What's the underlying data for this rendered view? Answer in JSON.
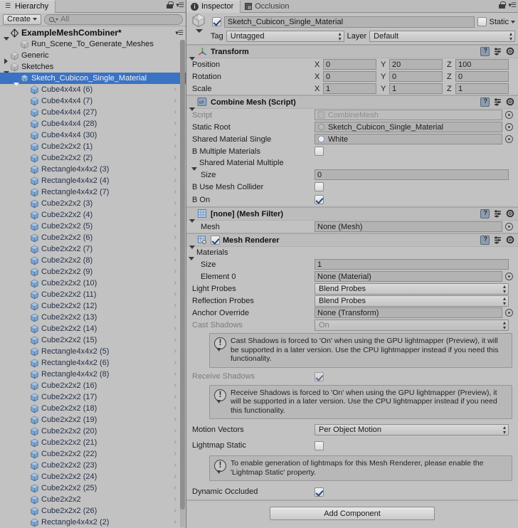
{
  "hierarchy": {
    "tab_label": "Hierarchy",
    "tab_icon": "hierarchy-icon",
    "create_label": "Create",
    "search_placeholder": "All",
    "search_value": "All",
    "scene_name": "ExampleMeshCombiner*",
    "selected_color": "#3a72c4",
    "items": [
      {
        "label": "Run_Scene_To_Generate_Meshes",
        "indent": 2,
        "arrow": "none",
        "icon": "gameobject-icon",
        "selected": false,
        "chevron": false
      },
      {
        "label": "Generic",
        "indent": 1,
        "arrow": "closed",
        "icon": "gameobject-icon",
        "selected": false,
        "chevron": false
      },
      {
        "label": "Sketches",
        "indent": 1,
        "arrow": "open",
        "icon": "gameobject-icon",
        "selected": false,
        "chevron": false
      },
      {
        "label": "Sketch_Cubicon_Single_Material",
        "indent": 2,
        "arrow": "open",
        "icon": "prefab-icon",
        "selected": true,
        "chevron": false
      },
      {
        "label": "Cube4x4x4 (6)",
        "indent": 3,
        "arrow": "none",
        "icon": "prefab-icon",
        "selected": false,
        "chevron": true
      },
      {
        "label": "Cube4x4x4 (7)",
        "indent": 3,
        "arrow": "none",
        "icon": "prefab-icon",
        "selected": false,
        "chevron": true
      },
      {
        "label": "Cube4x4x4 (27)",
        "indent": 3,
        "arrow": "none",
        "icon": "prefab-icon",
        "selected": false,
        "chevron": true
      },
      {
        "label": "Cube4x4x4 (28)",
        "indent": 3,
        "arrow": "none",
        "icon": "prefab-icon",
        "selected": false,
        "chevron": true
      },
      {
        "label": "Cube4x4x4 (30)",
        "indent": 3,
        "arrow": "none",
        "icon": "prefab-icon",
        "selected": false,
        "chevron": true
      },
      {
        "label": "Cube2x2x2 (1)",
        "indent": 3,
        "arrow": "none",
        "icon": "prefab-icon",
        "selected": false,
        "chevron": true
      },
      {
        "label": "Cube2x2x2 (2)",
        "indent": 3,
        "arrow": "none",
        "icon": "prefab-icon",
        "selected": false,
        "chevron": true
      },
      {
        "label": "Rectangle4x4x2 (3)",
        "indent": 3,
        "arrow": "none",
        "icon": "prefab-icon",
        "selected": false,
        "chevron": true
      },
      {
        "label": "Rectangle4x4x2 (4)",
        "indent": 3,
        "arrow": "none",
        "icon": "prefab-icon",
        "selected": false,
        "chevron": true
      },
      {
        "label": "Rectangle4x4x2 (7)",
        "indent": 3,
        "arrow": "none",
        "icon": "prefab-icon",
        "selected": false,
        "chevron": true
      },
      {
        "label": "Cube2x2x2 (3)",
        "indent": 3,
        "arrow": "none",
        "icon": "prefab-icon",
        "selected": false,
        "chevron": true
      },
      {
        "label": "Cube2x2x2 (4)",
        "indent": 3,
        "arrow": "none",
        "icon": "prefab-icon",
        "selected": false,
        "chevron": true
      },
      {
        "label": "Cube2x2x2 (5)",
        "indent": 3,
        "arrow": "none",
        "icon": "prefab-icon",
        "selected": false,
        "chevron": true
      },
      {
        "label": "Cube2x2x2 (6)",
        "indent": 3,
        "arrow": "none",
        "icon": "prefab-icon",
        "selected": false,
        "chevron": true
      },
      {
        "label": "Cube2x2x2 (7)",
        "indent": 3,
        "arrow": "none",
        "icon": "prefab-icon",
        "selected": false,
        "chevron": true
      },
      {
        "label": "Cube2x2x2 (8)",
        "indent": 3,
        "arrow": "none",
        "icon": "prefab-icon",
        "selected": false,
        "chevron": true
      },
      {
        "label": "Cube2x2x2 (9)",
        "indent": 3,
        "arrow": "none",
        "icon": "prefab-icon",
        "selected": false,
        "chevron": true
      },
      {
        "label": "Cube2x2x2 (10)",
        "indent": 3,
        "arrow": "none",
        "icon": "prefab-icon",
        "selected": false,
        "chevron": true
      },
      {
        "label": "Cube2x2x2 (11)",
        "indent": 3,
        "arrow": "none",
        "icon": "prefab-icon",
        "selected": false,
        "chevron": true
      },
      {
        "label": "Cube2x2x2 (12)",
        "indent": 3,
        "arrow": "none",
        "icon": "prefab-icon",
        "selected": false,
        "chevron": true
      },
      {
        "label": "Cube2x2x2 (13)",
        "indent": 3,
        "arrow": "none",
        "icon": "prefab-icon",
        "selected": false,
        "chevron": true
      },
      {
        "label": "Cube2x2x2 (14)",
        "indent": 3,
        "arrow": "none",
        "icon": "prefab-icon",
        "selected": false,
        "chevron": true
      },
      {
        "label": "Cube2x2x2 (15)",
        "indent": 3,
        "arrow": "none",
        "icon": "prefab-icon",
        "selected": false,
        "chevron": true
      },
      {
        "label": "Rectangle4x4x2 (5)",
        "indent": 3,
        "arrow": "none",
        "icon": "prefab-icon",
        "selected": false,
        "chevron": true
      },
      {
        "label": "Rectangle4x4x2 (6)",
        "indent": 3,
        "arrow": "none",
        "icon": "prefab-icon",
        "selected": false,
        "chevron": true
      },
      {
        "label": "Rectangle4x4x2 (8)",
        "indent": 3,
        "arrow": "none",
        "icon": "prefab-icon",
        "selected": false,
        "chevron": true
      },
      {
        "label": "Cube2x2x2 (16)",
        "indent": 3,
        "arrow": "none",
        "icon": "prefab-icon",
        "selected": false,
        "chevron": true
      },
      {
        "label": "Cube2x2x2 (17)",
        "indent": 3,
        "arrow": "none",
        "icon": "prefab-icon",
        "selected": false,
        "chevron": true
      },
      {
        "label": "Cube2x2x2 (18)",
        "indent": 3,
        "arrow": "none",
        "icon": "prefab-icon",
        "selected": false,
        "chevron": true
      },
      {
        "label": "Cube2x2x2 (19)",
        "indent": 3,
        "arrow": "none",
        "icon": "prefab-icon",
        "selected": false,
        "chevron": true
      },
      {
        "label": "Cube2x2x2 (20)",
        "indent": 3,
        "arrow": "none",
        "icon": "prefab-icon",
        "selected": false,
        "chevron": true
      },
      {
        "label": "Cube2x2x2 (21)",
        "indent": 3,
        "arrow": "none",
        "icon": "prefab-icon",
        "selected": false,
        "chevron": true
      },
      {
        "label": "Cube2x2x2 (22)",
        "indent": 3,
        "arrow": "none",
        "icon": "prefab-icon",
        "selected": false,
        "chevron": true
      },
      {
        "label": "Cube2x2x2 (23)",
        "indent": 3,
        "arrow": "none",
        "icon": "prefab-icon",
        "selected": false,
        "chevron": true
      },
      {
        "label": "Cube2x2x2 (24)",
        "indent": 3,
        "arrow": "none",
        "icon": "prefab-icon",
        "selected": false,
        "chevron": true
      },
      {
        "label": "Cube2x2x2 (25)",
        "indent": 3,
        "arrow": "none",
        "icon": "prefab-icon",
        "selected": false,
        "chevron": true
      },
      {
        "label": "Cube2x2x2",
        "indent": 3,
        "arrow": "none",
        "icon": "prefab-icon",
        "selected": false,
        "chevron": true
      },
      {
        "label": "Cube2x2x2 (26)",
        "indent": 3,
        "arrow": "none",
        "icon": "prefab-icon",
        "selected": false,
        "chevron": true
      },
      {
        "label": "Rectangle4x4x2 (2)",
        "indent": 3,
        "arrow": "none",
        "icon": "prefab-icon",
        "selected": false,
        "chevron": true
      }
    ]
  },
  "inspector": {
    "tabs": [
      {
        "label": "Inspector",
        "icon": "info-icon",
        "active": true
      },
      {
        "label": "Occlusion",
        "icon": "occlusion-icon",
        "active": false
      }
    ],
    "gameobject": {
      "enabled": true,
      "name": "Sketch_Cubicon_Single_Material",
      "static_label": "Static",
      "static_checked": false,
      "tag_label": "Tag",
      "tag_value": "Untagged",
      "layer_label": "Layer",
      "layer_value": "Default"
    },
    "transform": {
      "title": "Transform",
      "icon": "transform-icon",
      "rows": [
        {
          "label": "Position",
          "x": "0",
          "y": "20",
          "z": "100"
        },
        {
          "label": "Rotation",
          "x": "0",
          "y": "0",
          "z": "0"
        },
        {
          "label": "Scale",
          "x": "1",
          "y": "1",
          "z": "1"
        }
      ],
      "axis_labels": [
        "X",
        "Y",
        "Z"
      ]
    },
    "combine_mesh": {
      "title": "Combine Mesh (Script)",
      "icon": "script-icon",
      "script_label": "Script",
      "script_value": "CombineMesh",
      "static_root_label": "Static Root",
      "static_root_value": "Sketch_Cubicon_Single_Material",
      "shared_material_single_label": "Shared Material Single",
      "shared_material_single_value": "White",
      "b_multiple_materials_label": "B Multiple Materials",
      "b_multiple_materials_checked": false,
      "shared_material_multiple_label": "Shared Material Multiple",
      "size_label": "Size",
      "size_value": "0",
      "b_use_mesh_collider_label": "B Use Mesh Collider",
      "b_use_mesh_collider_checked": false,
      "b_on_label": "B On",
      "b_on_checked": true
    },
    "mesh_filter": {
      "title": "[none] (Mesh Filter)",
      "icon": "mesh-filter-icon",
      "mesh_label": "Mesh",
      "mesh_value": "None (Mesh)"
    },
    "mesh_renderer": {
      "title": "Mesh Renderer",
      "icon": "mesh-renderer-icon",
      "enabled": true,
      "materials_label": "Materials",
      "size_label": "Size",
      "size_value": "1",
      "element0_label": "Element 0",
      "element0_value": "None (Material)",
      "light_probes_label": "Light Probes",
      "light_probes_value": "Blend Probes",
      "reflection_probes_label": "Reflection Probes",
      "reflection_probes_value": "Blend Probes",
      "anchor_override_label": "Anchor Override",
      "anchor_override_value": "None (Transform)",
      "cast_shadows_label": "Cast Shadows",
      "cast_shadows_value": "On",
      "cast_shadows_help": "Cast Shadows is forced to 'On' when using the GPU lightmapper (Preview), it will be supported in a later version. Use the CPU lightmapper instead if you need this functionality.",
      "receive_shadows_label": "Receive Shadows",
      "receive_shadows_checked": true,
      "receive_shadows_help": "Receive Shadows is forced to 'On' when using the GPU lightmapper (Preview), it will be supported in a later version. Use the CPU lightmapper instead if you need this functionality.",
      "motion_vectors_label": "Motion Vectors",
      "motion_vectors_value": "Per Object Motion",
      "lightmap_static_label": "Lightmap Static",
      "lightmap_static_checked": false,
      "lightmap_static_help": "To enable generation of lightmaps for this Mesh Renderer, please enable the 'Lightmap Static' property.",
      "dynamic_occluded_label": "Dynamic Occluded",
      "dynamic_occluded_checked": true
    },
    "add_component_label": "Add Component"
  }
}
